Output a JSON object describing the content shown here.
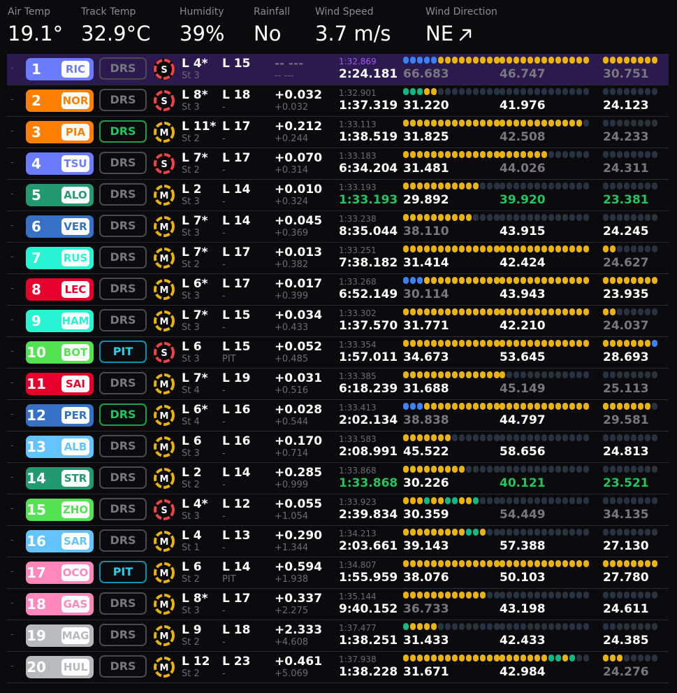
{
  "weather": [
    {
      "label": "Air Temp",
      "value": "19.1°"
    },
    {
      "label": "Track Temp",
      "value": "32.9°C"
    },
    {
      "label": "Humidity",
      "value": "39%"
    },
    {
      "label": "Rainfall",
      "value": "No"
    },
    {
      "label": "Wind Speed",
      "value": "3.7 m/s"
    },
    {
      "label": "Wind Direction",
      "value": "NE",
      "icon": "arrow-northeast-icon"
    }
  ],
  "colors": {
    "soft": "#ef4444",
    "medium": "#eab308",
    "segment_yellow": "#eab308",
    "segment_green": "#10b981",
    "segment_blue": "#3b82f6",
    "segment_purple": "#a855f7",
    "highlight_row": "#2a1a4d"
  },
  "drivers": [
    {
      "pos": "1",
      "tla": "RIC",
      "color": "#6b7cff",
      "drs": "DRS",
      "drs_state": "off",
      "tyre": "S",
      "lap": "L 4*",
      "stint": "St 3",
      "laps": "L 15",
      "laps_sub": "",
      "gap": "-- ---",
      "gap_sub": "-- ---",
      "gap_muted": true,
      "best": "1:32.869",
      "best_state": "purple",
      "last": "2:24.181",
      "last_state": "white",
      "sectors": [
        {
          "segs": "bbbbbyyyyyyyyy",
          "time": "66.683",
          "state": "grey"
        },
        {
          "segs": "yyyyyyyyyyyyy",
          "time": "46.747",
          "state": "grey"
        },
        {
          "segs": "yyyyyyyy",
          "time": "30.751",
          "state": "grey"
        }
      ]
    },
    {
      "pos": "2",
      "tla": "NOR",
      "color": "#ff8000",
      "drs": "DRS",
      "drs_state": "off",
      "tyre": "S",
      "lap": "L 8*",
      "stint": "St 3",
      "laps": "L 18",
      "laps_sub": "-",
      "gap": "+0.032",
      "gap_sub": "+0.032",
      "best": "1:32.901",
      "best_state": "grey",
      "last": "1:37.319",
      "last_state": "white",
      "sectors": [
        {
          "segs": "gggyy.........",
          "time": "31.220",
          "state": "white"
        },
        {
          "segs": ".............",
          "time": "41.976",
          "state": "white"
        },
        {
          "segs": "........",
          "time": "24.123",
          "state": "white"
        }
      ]
    },
    {
      "pos": "3",
      "tla": "PIA",
      "color": "#ff8000",
      "drs": "DRS",
      "drs_state": "on",
      "tyre": "M",
      "lap": "L 11*",
      "stint": "St 2",
      "laps": "L 17",
      "laps_sub": "-",
      "gap": "+0.212",
      "gap_sub": "+0.244",
      "best": "1:33.113",
      "best_state": "grey",
      "last": "1:38.519",
      "last_state": "white",
      "sectors": [
        {
          "segs": "yyyyyyyyyyyyyy",
          "time": "31.825",
          "state": "white"
        },
        {
          "segs": "yyyyyyyyyyyy.",
          "time": "42.508",
          "state": "grey"
        },
        {
          "segs": "........",
          "time": "24.233",
          "state": "grey"
        }
      ]
    },
    {
      "pos": "4",
      "tla": "TSU",
      "color": "#6b7cff",
      "drs": "DRS",
      "drs_state": "off",
      "tyre": "S",
      "lap": "L 7*",
      "stint": "St 2",
      "laps": "L 17",
      "laps_sub": "-",
      "gap": "+0.070",
      "gap_sub": "+0.314",
      "best": "1:33.183",
      "best_state": "grey",
      "last": "6:34.204",
      "last_state": "white",
      "sectors": [
        {
          "segs": "yyyyyyyyyyyyyy",
          "time": "31.481",
          "state": "white"
        },
        {
          "segs": "yyyyyyy......",
          "time": "44.026",
          "state": "grey"
        },
        {
          "segs": "........",
          "time": "24.311",
          "state": "grey"
        }
      ]
    },
    {
      "pos": "5",
      "tla": "ALO",
      "color": "#229971",
      "drs": "DRS",
      "drs_state": "off",
      "tyre": "M",
      "lap": "L 2",
      "stint": "St 3",
      "laps": "L 14",
      "laps_sub": "-",
      "gap": "+0.010",
      "gap_sub": "+0.324",
      "best": "1:33.193",
      "best_state": "grey",
      "last": "1:33.193",
      "last_state": "green",
      "sectors": [
        {
          "segs": "yyyyyyyyyyy...",
          "time": "29.892",
          "state": "white"
        },
        {
          "segs": ".............",
          "time": "39.920",
          "state": "green"
        },
        {
          "segs": "........",
          "time": "23.381",
          "state": "green"
        }
      ]
    },
    {
      "pos": "6",
      "tla": "VER",
      "color": "#3671c6",
      "drs": "DRS",
      "drs_state": "off",
      "tyre": "M",
      "lap": "L 7*",
      "stint": "St 3",
      "laps": "L 14",
      "laps_sub": "-",
      "gap": "+0.045",
      "gap_sub": "+0.369",
      "best": "1:33.238",
      "best_state": "grey",
      "last": "8:35.044",
      "last_state": "white",
      "sectors": [
        {
          "segs": "yyyyyyyyyy....",
          "time": "38.110",
          "state": "grey"
        },
        {
          "segs": ".............",
          "time": "43.915",
          "state": "white"
        },
        {
          "segs": "........",
          "time": "24.245",
          "state": "white"
        }
      ]
    },
    {
      "pos": "7",
      "tla": "RUS",
      "color": "#27f4d2",
      "drs": "DRS",
      "drs_state": "off",
      "tyre": "M",
      "lap": "L 7*",
      "stint": "St 2",
      "laps": "L 17",
      "laps_sub": "-",
      "gap": "+0.013",
      "gap_sub": "+0.382",
      "best": "1:33.251",
      "best_state": "grey",
      "last": "7:38.182",
      "last_state": "white",
      "sectors": [
        {
          "segs": "yyyyyyyyyyyyyy",
          "time": "31.414",
          "state": "white"
        },
        {
          "segs": "yyyyyyyyyyyyy",
          "time": "42.424",
          "state": "white"
        },
        {
          "segs": "yy......",
          "time": "24.627",
          "state": "grey"
        }
      ]
    },
    {
      "pos": "8",
      "tla": "LEC",
      "color": "#e8002d",
      "drs": "DRS",
      "drs_state": "off",
      "tyre": "M",
      "lap": "L 6*",
      "stint": "St 3",
      "laps": "L 17",
      "laps_sub": "-",
      "gap": "+0.017",
      "gap_sub": "+0.399",
      "best": "1:33.268",
      "best_state": "grey",
      "last": "6:52.149",
      "last_state": "white",
      "sectors": [
        {
          "segs": "bbbyyyyyyyyyyy",
          "time": "30.114",
          "state": "grey"
        },
        {
          "segs": "yyyyyyyyyyyyy",
          "time": "43.943",
          "state": "white"
        },
        {
          "segs": "yyyyyyyy",
          "time": "23.935",
          "state": "white"
        }
      ]
    },
    {
      "pos": "9",
      "tla": "HAM",
      "color": "#27f4d2",
      "drs": "DRS",
      "drs_state": "off",
      "tyre": "M",
      "lap": "L 7*",
      "stint": "St 3",
      "laps": "L 15",
      "laps_sub": "-",
      "gap": "+0.034",
      "gap_sub": "+0.433",
      "best": "1:33.302",
      "best_state": "grey",
      "last": "1:37.570",
      "last_state": "white",
      "sectors": [
        {
          "segs": "yyyyyyyyyyyyyy",
          "time": "31.771",
          "state": "white"
        },
        {
          "segs": "yyyyyyyyyyyyy",
          "time": "42.210",
          "state": "white"
        },
        {
          "segs": "yy......",
          "time": "24.037",
          "state": "grey"
        }
      ]
    },
    {
      "pos": "10",
      "tla": "BOT",
      "color": "#52e252",
      "drs": "PIT",
      "drs_state": "pit",
      "tyre": "S",
      "lap": "L 6",
      "stint": "St 3",
      "laps": "L 15",
      "laps_sub": "PIT",
      "gap": "+0.052",
      "gap_sub": "+0.485",
      "best": "1:33.354",
      "best_state": "grey",
      "last": "1:57.011",
      "last_state": "white",
      "sectors": [
        {
          "segs": "yyyyyyyyyyyyyy",
          "time": "34.673",
          "state": "white"
        },
        {
          "segs": "yyyyyyyyyyyyy",
          "time": "53.645",
          "state": "white"
        },
        {
          "segs": "yyyyyyyb",
          "time": "28.693",
          "state": "white"
        }
      ]
    },
    {
      "pos": "11",
      "tla": "SAI",
      "color": "#e8002d",
      "drs": "DRS",
      "drs_state": "off",
      "tyre": "M",
      "lap": "L 7*",
      "stint": "St 4",
      "laps": "L 19",
      "laps_sub": "-",
      "gap": "+0.031",
      "gap_sub": "+0.516",
      "best": "1:33.385",
      "best_state": "grey",
      "last": "6:18.239",
      "last_state": "white",
      "sectors": [
        {
          "segs": "yyyyyyyyyyyyyy",
          "time": "31.688",
          "state": "white"
        },
        {
          "segs": "y............",
          "time": "45.149",
          "state": "grey"
        },
        {
          "segs": "........",
          "time": "25.113",
          "state": "grey"
        }
      ]
    },
    {
      "pos": "12",
      "tla": "PER",
      "color": "#3671c6",
      "drs": "DRS",
      "drs_state": "on",
      "tyre": "M",
      "lap": "L 6*",
      "stint": "St 4",
      "laps": "L 16",
      "laps_sub": "-",
      "gap": "+0.028",
      "gap_sub": "+0.544",
      "best": "1:33.413",
      "best_state": "grey",
      "last": "2:02.134",
      "last_state": "white",
      "sectors": [
        {
          "segs": "bbbyyyyyyyyyyy",
          "time": "38.838",
          "state": "grey"
        },
        {
          "segs": "yyyyyyyyyyyyy",
          "time": "44.797",
          "state": "white"
        },
        {
          "segs": "yyyyyyy.",
          "time": "29.581",
          "state": "grey"
        }
      ]
    },
    {
      "pos": "13",
      "tla": "ALB",
      "color": "#64c4ff",
      "drs": "DRS",
      "drs_state": "off",
      "tyre": "M",
      "lap": "L 6",
      "stint": "St 3",
      "laps": "L 16",
      "laps_sub": "-",
      "gap": "+0.170",
      "gap_sub": "+0.714",
      "best": "1:33.583",
      "best_state": "grey",
      "last": "2:08.991",
      "last_state": "white",
      "sectors": [
        {
          "segs": "yyyyyyy.......",
          "time": "45.522",
          "state": "white"
        },
        {
          "segs": ".............",
          "time": "58.656",
          "state": "white"
        },
        {
          "segs": "........",
          "time": "24.813",
          "state": "white"
        }
      ]
    },
    {
      "pos": "14",
      "tla": "STR",
      "color": "#229971",
      "drs": "DRS",
      "drs_state": "off",
      "tyre": "M",
      "lap": "L 2",
      "stint": "St 2",
      "laps": "L 14",
      "laps_sub": "-",
      "gap": "+0.285",
      "gap_sub": "+0.999",
      "best": "1:33.868",
      "best_state": "grey",
      "last": "1:33.868",
      "last_state": "green",
      "sectors": [
        {
          "segs": "yyyyyyyyy.....",
          "time": "30.226",
          "state": "white"
        },
        {
          "segs": ".............",
          "time": "40.121",
          "state": "green"
        },
        {
          "segs": "........",
          "time": "23.521",
          "state": "green"
        }
      ]
    },
    {
      "pos": "15",
      "tla": "ZHO",
      "color": "#52e252",
      "drs": "DRS",
      "drs_state": "off",
      "tyre": "S",
      "lap": "L 4*",
      "stint": "St 3",
      "laps": "L 12",
      "laps_sub": "-",
      "gap": "+0.055",
      "gap_sub": "+1.054",
      "best": "1:33.923",
      "best_state": "grey",
      "last": "2:39.834",
      "last_state": "white",
      "sectors": [
        {
          "segs": "yyygyyggyyg...",
          "time": "30.359",
          "state": "white"
        },
        {
          "segs": ".............",
          "time": "54.449",
          "state": "grey"
        },
        {
          "segs": "........",
          "time": "34.135",
          "state": "grey"
        }
      ]
    },
    {
      "pos": "16",
      "tla": "SAR",
      "color": "#64c4ff",
      "drs": "DRS",
      "drs_state": "off",
      "tyre": "M",
      "lap": "L 4",
      "stint": "St 1",
      "laps": "L 13",
      "laps_sub": "-",
      "gap": "+0.290",
      "gap_sub": "+1.344",
      "best": "1:34.213",
      "best_state": "grey",
      "last": "2:03.661",
      "last_state": "white",
      "sectors": [
        {
          "segs": "yyyyyyyyyggy..",
          "time": "39.143",
          "state": "white"
        },
        {
          "segs": ".............",
          "time": "57.388",
          "state": "white"
        },
        {
          "segs": "........",
          "time": "27.130",
          "state": "white"
        }
      ]
    },
    {
      "pos": "17",
      "tla": "OCO",
      "color": "#ff87bc",
      "drs": "PIT",
      "drs_state": "pit",
      "tyre": "M",
      "lap": "L 6",
      "stint": "St 2",
      "laps": "L 14",
      "laps_sub": "PIT",
      "gap": "+0.594",
      "gap_sub": "+1.938",
      "best": "1:34.807",
      "best_state": "grey",
      "last": "1:55.959",
      "last_state": "white",
      "sectors": [
        {
          "segs": "yyyyyyyyyyyyyy",
          "time": "38.076",
          "state": "white"
        },
        {
          "segs": "yyyyyyyyyyyyy",
          "time": "50.103",
          "state": "white"
        },
        {
          "segs": "yyyyyyyy",
          "time": "27.780",
          "state": "white"
        }
      ]
    },
    {
      "pos": "18",
      "tla": "GAS",
      "color": "#ff87bc",
      "drs": "DRS",
      "drs_state": "off",
      "tyre": "M",
      "lap": "L 8*",
      "stint": "St 3",
      "laps": "L 17",
      "laps_sub": "-",
      "gap": "+0.337",
      "gap_sub": "+2.275",
      "best": "1:35.144",
      "best_state": "grey",
      "last": "9:40.152",
      "last_state": "white",
      "sectors": [
        {
          "segs": "yyyyyyyyyyyy..",
          "time": "36.733",
          "state": "grey"
        },
        {
          "segs": ".............",
          "time": "43.198",
          "state": "white"
        },
        {
          "segs": "........",
          "time": "24.611",
          "state": "white"
        }
      ]
    },
    {
      "pos": "19",
      "tla": "MAG",
      "color": "#b6babd",
      "drs": "DRS",
      "drs_state": "off",
      "tyre": "M",
      "lap": "L 9",
      "stint": "St 2",
      "laps": "L 18",
      "laps_sub": "-",
      "gap": "+2.333",
      "gap_sub": "+4.608",
      "best": "1:37.477",
      "best_state": "grey",
      "last": "1:38.251",
      "last_state": "white",
      "sectors": [
        {
          "segs": "gyyyy.........",
          "time": "31.433",
          "state": "white"
        },
        {
          "segs": ".............",
          "time": "42.433",
          "state": "white"
        },
        {
          "segs": "........",
          "time": "24.385",
          "state": "white"
        }
      ]
    },
    {
      "pos": "20",
      "tla": "HUL",
      "color": "#b6babd",
      "drs": "DRS",
      "drs_state": "off",
      "tyre": "M",
      "lap": "L 12",
      "stint": "St 2",
      "laps": "L 23",
      "laps_sub": "-",
      "gap": "+0.461",
      "gap_sub": "+5.069",
      "best": "1:37.938",
      "best_state": "grey",
      "last": "1:38.228",
      "last_state": "white",
      "sectors": [
        {
          "segs": "yyyyyyyyyyyyyy",
          "time": "31.671",
          "state": "white"
        },
        {
          "segs": "yyyyyyyggyg..",
          "time": "42.984",
          "state": "white"
        },
        {
          "segs": "yyy.....",
          "time": "24.276",
          "state": "grey"
        }
      ]
    }
  ]
}
